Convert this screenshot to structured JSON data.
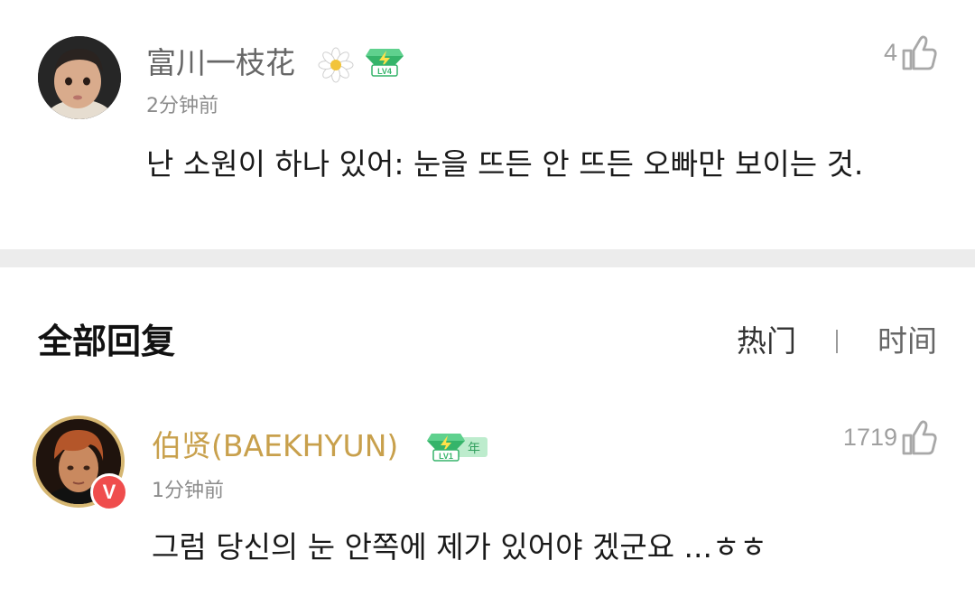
{
  "parent_comment": {
    "username": "富川一枝花",
    "timestamp": "2分钟前",
    "like_count": "4",
    "text": "난 소원이 하나 있어: 눈을 뜨든 안 뜨든 오빠만 보이는 것.",
    "level_badge": "LV4",
    "icons": [
      "avatar",
      "daisy-flower-icon",
      "level-badge-icon",
      "thumbs-up-icon"
    ]
  },
  "replies_section": {
    "title": "全部回复",
    "sort_tabs": [
      {
        "label": "热门",
        "active": true
      },
      {
        "label": "时间",
        "active": false
      }
    ],
    "separator": "|"
  },
  "reply": {
    "username": "伯贤(BAEKHYUN)",
    "timestamp": "1分钟前",
    "like_count": "1719",
    "text": "그럼 당신의 눈 안쪽에 제가 있어야 겠군요 ...ㅎㅎ",
    "level_badge": "LV1",
    "year_badge": "年",
    "verified_mark": "V",
    "icons": [
      "avatar",
      "verified-icon",
      "level-badge-icon",
      "thumbs-up-icon"
    ]
  },
  "colors": {
    "gold_username": "#c8a04c",
    "badge_green": "#35b46a",
    "verified_red": "#ef4d4d",
    "divider": "#ececec"
  }
}
